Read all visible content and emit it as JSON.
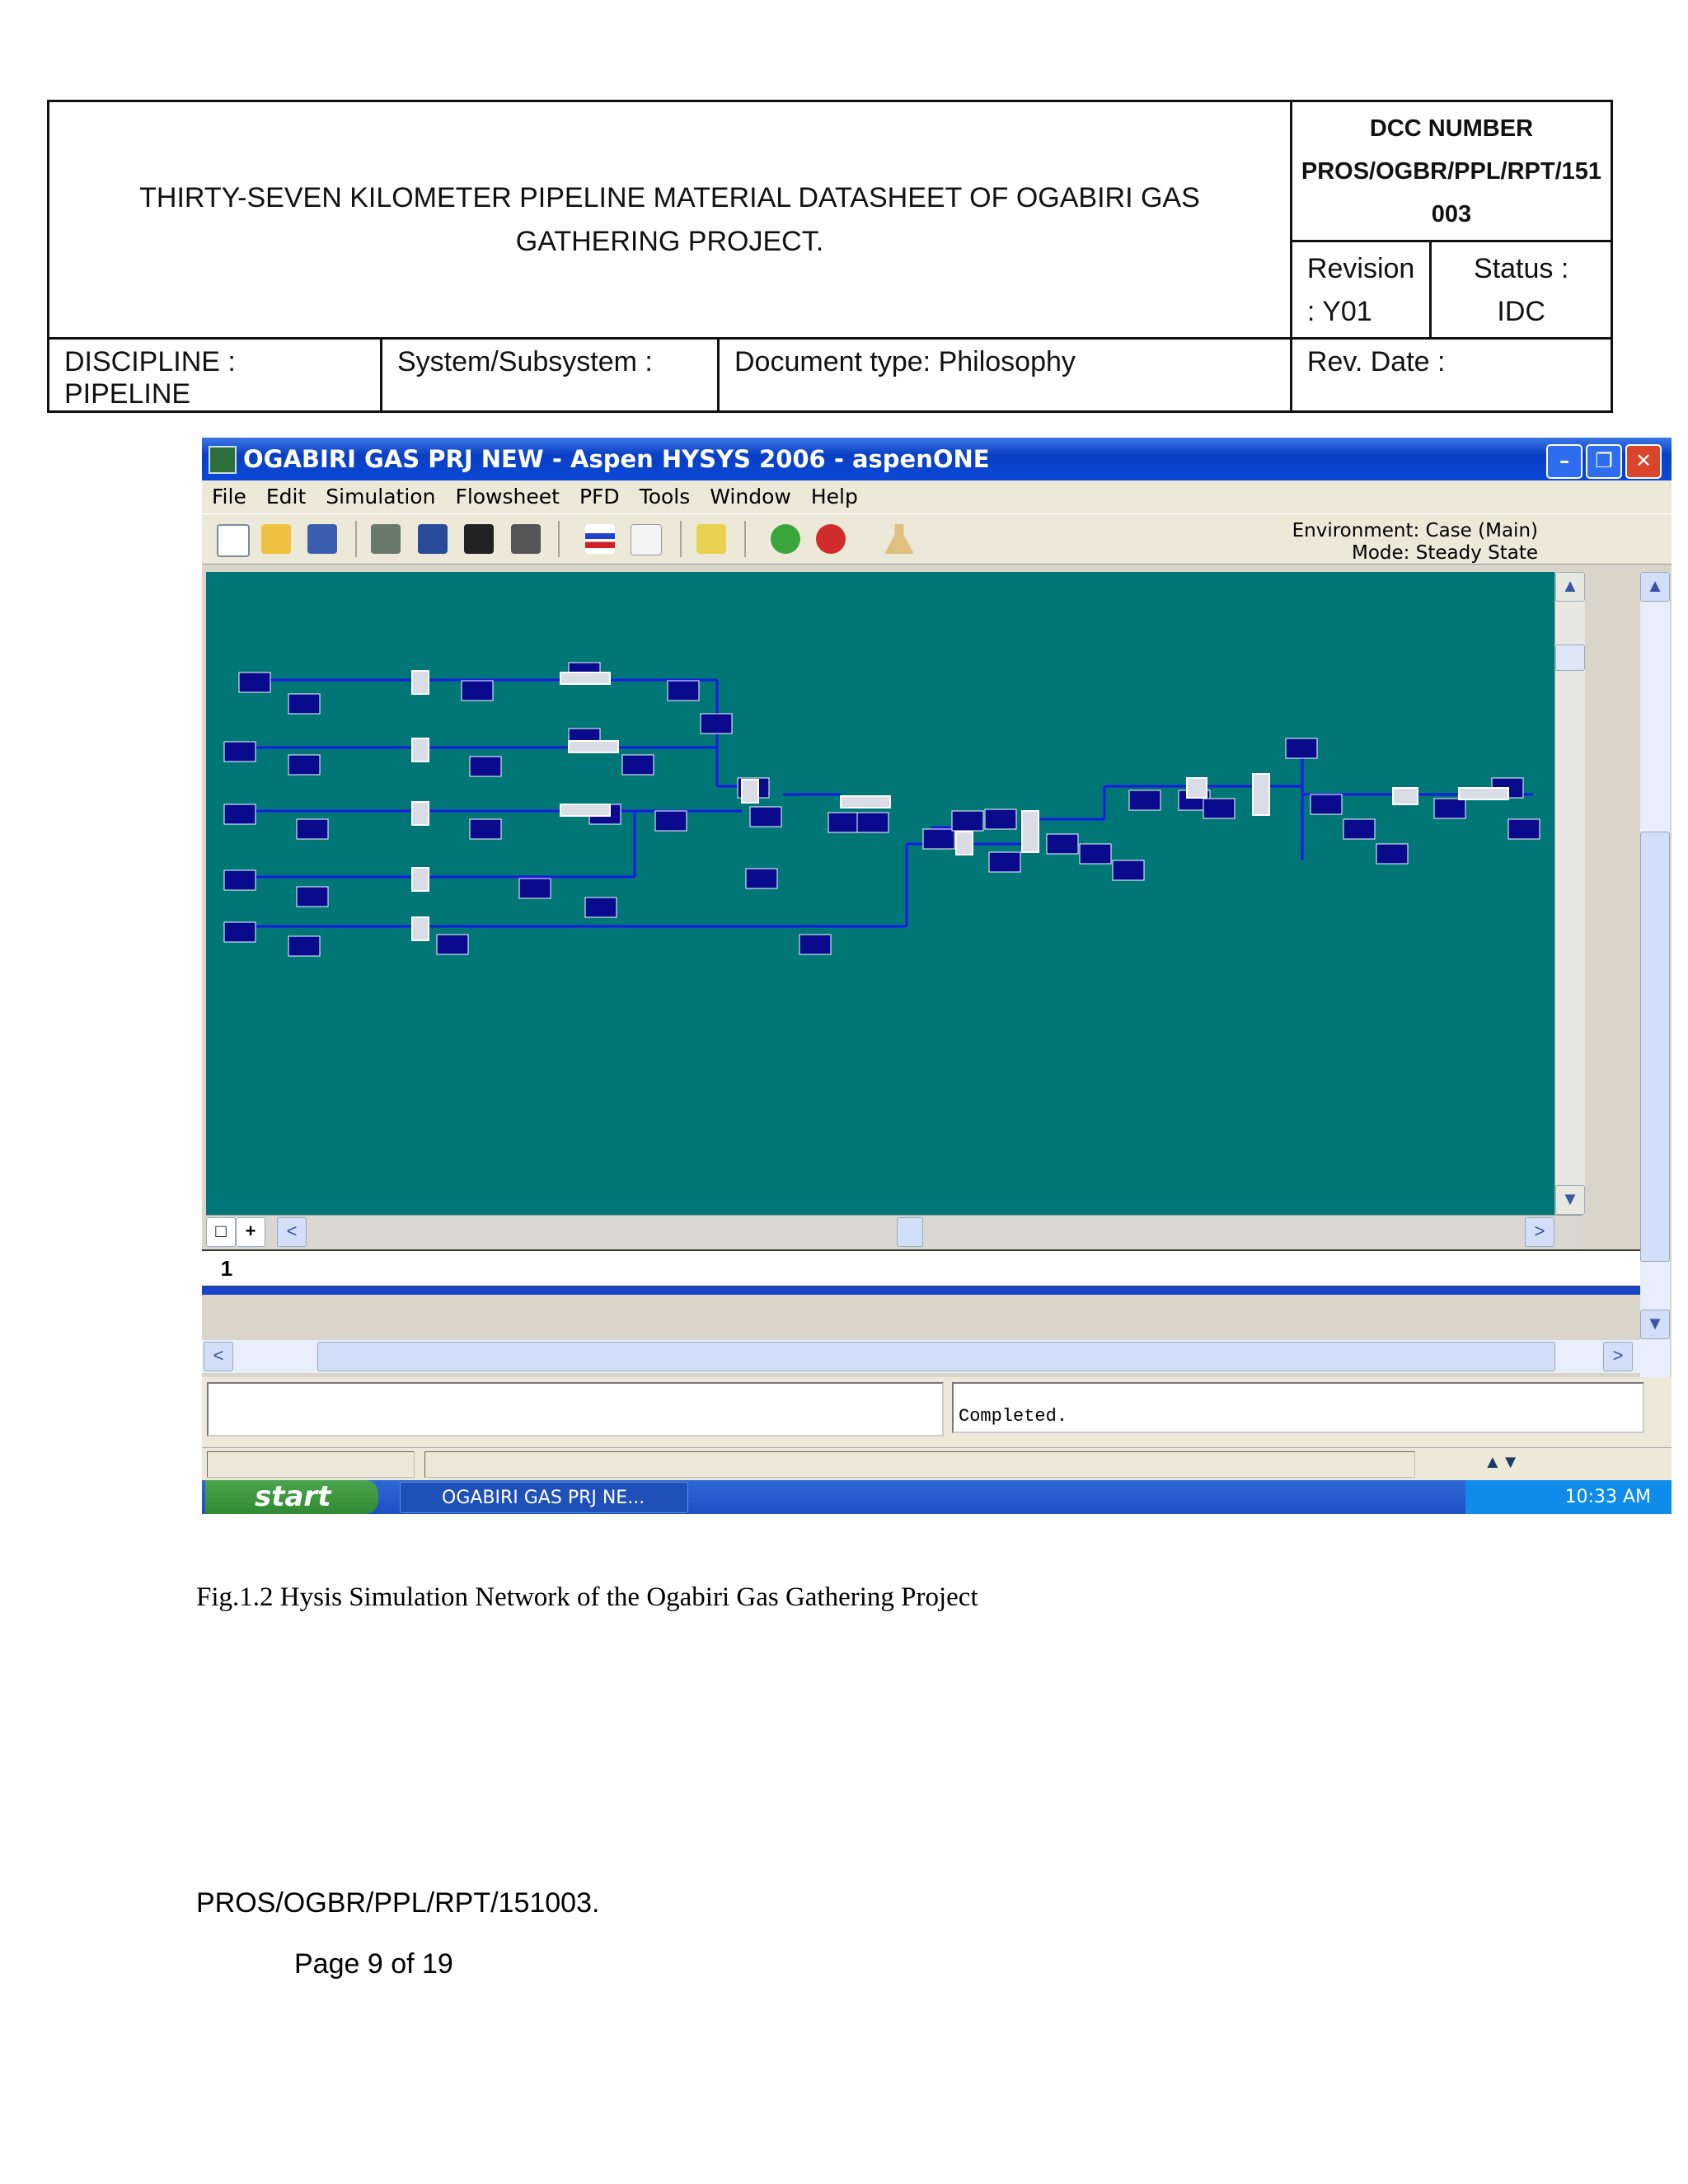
{
  "header": {
    "title": "THIRTY-SEVEN KILOMETER PIPELINE MATERIAL DATASHEET OF OGABIRI GAS GATHERING PROJECT.",
    "dcc_label": "DCC NUMBER",
    "dcc_number": "PROS/OGBR/PPL/RPT/151003",
    "revision": "Revision : Y01",
    "status": "Status : IDC",
    "discipline": "DISCIPLINE : PIPELINE",
    "system": "System/Subsystem :",
    "document_type": "Document type: Philosophy",
    "rev_date": "Rev. Date :"
  },
  "screenshot": {
    "window_title": "OGABIRI GAS PRJ NEW - Aspen HYSYS 2006 - aspenONE",
    "menu": [
      "File",
      "Edit",
      "Simulation",
      "Flowsheet",
      "PFD",
      "Tools",
      "Window",
      "Help"
    ],
    "environment": "Environment: Case (Main)",
    "mode": "Mode: Steady State",
    "pfd_tab": "1",
    "status_message": "Completed.",
    "start_label": "start",
    "taskbar_item": "OGABIRI GAS PRJ NE...",
    "clock": "10:33 AM",
    "colors": {
      "pfd_background": "#007676",
      "stream_line": "#1a1ae6",
      "block_fill": "#0a0a8c",
      "titlebar": "#0b48d6"
    }
  },
  "caption": "Fig.1.2 Hysis Simulation Network of the Ogabiri Gas Gathering Project",
  "footer": {
    "doc_number": "PROS/OGBR/PPL/RPT/151003.",
    "page": "Page 9 of 19"
  }
}
